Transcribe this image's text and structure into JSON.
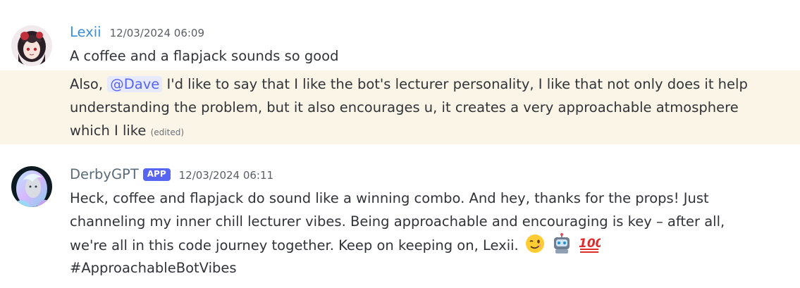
{
  "messages": [
    {
      "author": "Lexii",
      "author_color": "#3a8fd6",
      "timestamp": "12/03/2024 06:09",
      "lines": [
        "A coffee and a flapjack sounds so good"
      ],
      "second": {
        "prefix": "Also, ",
        "mention": "@Dave",
        "text": " I'd like to say that I like the bot's lecturer personality, I like that not only does it help understanding the problem, but it also encourages u, it creates a very approachable atmosphere which I like",
        "edited_label": "(edited)",
        "highlight_color": "#fbf5e7"
      }
    },
    {
      "author": "DerbyGPT",
      "author_color": "#5b6c79",
      "badge": "APP",
      "timestamp": "12/03/2024 06:11",
      "text": "Heck, coffee and flapjack do sound like a winning combo. And hey, thanks for the props! Just channeling my inner chill lecturer vibes. Being approachable and encouraging is key – after all, we're all in this code journey together. Keep on keeping on, Lexii.",
      "emojis": [
        "winking-face-emoji",
        "robot-emoji",
        "hundred-points-emoji"
      ],
      "hashtag": "#ApproachableBotVibes"
    }
  ]
}
